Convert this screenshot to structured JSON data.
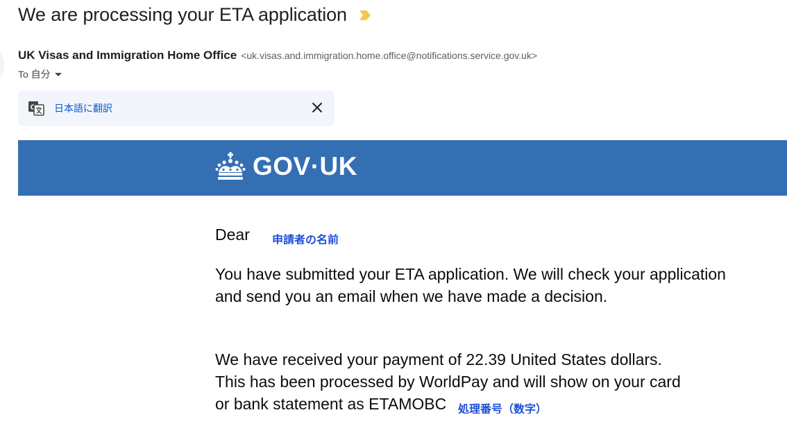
{
  "email": {
    "subject": "We are processing your ETA application",
    "sender_name": "UK Visas and Immigration Home Office",
    "sender_email": "<uk.visas.and.immigration.home.office@notifications.service.gov.uk>",
    "to_label": "To 自分"
  },
  "translate_bar": {
    "link_label": "日本語に翻訳"
  },
  "gov_header": {
    "wordmark": "GOV·UK",
    "background_color": "#346fb4"
  },
  "body": {
    "greeting": "Dear",
    "name_annotation": "申請者の名前",
    "paragraph_1": "You have submitted your ETA application. We will check your application and send you an email when we have made a decision.",
    "paragraph_2_lines": [
      "We have received your payment of 22.39 United States dollars.",
      "This has been processed by WorldPay and will show on your card",
      "or bank statement as ETAMOBC"
    ],
    "reference_annotation": "処理番号（数字）"
  },
  "icons": {
    "important": "important-marker-icon",
    "translate": "translate-icon",
    "close": "close-icon",
    "crown": "crown-icon",
    "caret": "chevron-down-icon"
  }
}
